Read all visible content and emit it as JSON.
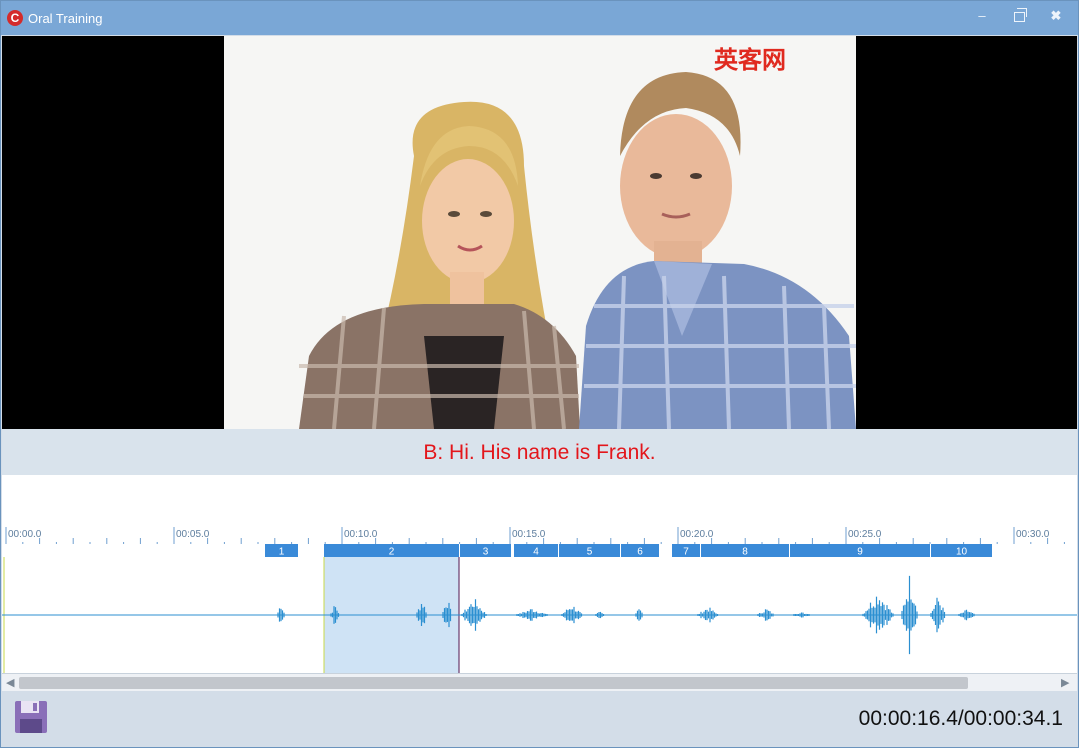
{
  "window": {
    "title": "Oral Training",
    "app_icon": "C",
    "minimize_glyph": "–",
    "close_glyph": "✖"
  },
  "video": {
    "watermark": "英客网"
  },
  "subtitle": {
    "text": "B: Hi.  His name is Frank.",
    "color": "#e3161b"
  },
  "timeline": {
    "ruler_labels": [
      "00:00.0",
      "00:05.0",
      "00:10.0",
      "00:15.0",
      "00:20.0",
      "00:25.0",
      "00:30.0"
    ],
    "segments": [
      "1",
      "2",
      "3",
      "4",
      "5",
      "6",
      "7",
      "8",
      "9",
      "10"
    ],
    "selected_segment": "2",
    "accent_color": "#3a8ad8",
    "waveform_color": "#2b8fd1",
    "selection_color": "#cfe3f5"
  },
  "playback": {
    "time": "00:00:16.4/00:00:34.1"
  },
  "icons": {
    "app": "app-logo-icon",
    "save": "save-floppy-icon",
    "minimize": "minimize-icon",
    "restore": "restore-icon",
    "close": "close-icon"
  }
}
